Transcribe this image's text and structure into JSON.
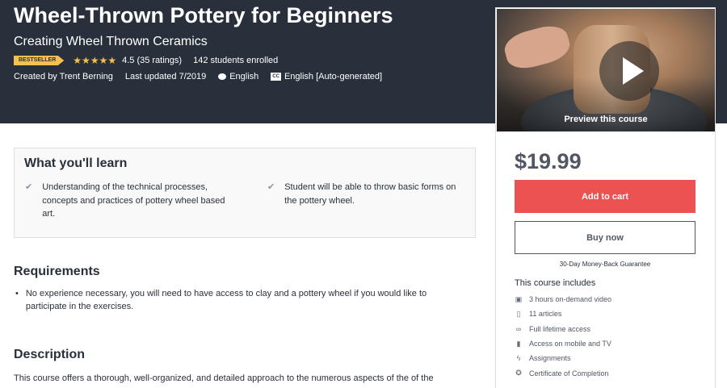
{
  "header": {
    "title": "Wheel-Thrown Pottery for Beginners",
    "subtitle": "Creating Wheel Thrown Ceramics",
    "badge": "BESTSELLER",
    "stars": "★★★★★",
    "rating": "4.5 (35 ratings)",
    "enrolled": "142 students enrolled",
    "created_by": "Created by Trent Berning",
    "last_updated": "Last updated 7/2019",
    "language": "English",
    "captions": "English [Auto-generated]"
  },
  "sidebar": {
    "preview_label": "Preview this course",
    "price": "$19.99",
    "add_to_cart": "Add to cart",
    "buy_now": "Buy now",
    "guarantee": "30-Day Money-Back Guarantee",
    "includes_title": "This course includes",
    "includes": [
      {
        "icon": "video-icon",
        "glyph": "▣",
        "label": "3 hours on-demand video"
      },
      {
        "icon": "file-icon",
        "glyph": "▯",
        "label": "11 articles"
      },
      {
        "icon": "infinity-icon",
        "glyph": "∞",
        "label": "Full lifetime access"
      },
      {
        "icon": "mobile-icon",
        "glyph": "▮",
        "label": "Access on mobile and TV"
      },
      {
        "icon": "bolt-icon",
        "glyph": "ϟ",
        "label": "Assignments"
      },
      {
        "icon": "trophy-icon",
        "glyph": "✪",
        "label": "Certificate of Completion"
      }
    ]
  },
  "learn": {
    "title": "What you'll learn",
    "items": [
      "Understanding of the technical processes, concepts and practices of pottery wheel based art.",
      "Student will be able to throw basic forms on the pottery wheel."
    ]
  },
  "requirements": {
    "title": "Requirements",
    "items": [
      "No experience necessary, you will need to have access to clay and a pottery wheel if you would like to participate in the exercises."
    ]
  },
  "description": {
    "title": "Description",
    "text": "This course offers a thorough, well-organized, and detailed approach to the numerous aspects of the of the"
  },
  "colors": {
    "header_bg": "#29303b",
    "badge": "#f4c150",
    "cart_button": "#ec5252"
  }
}
